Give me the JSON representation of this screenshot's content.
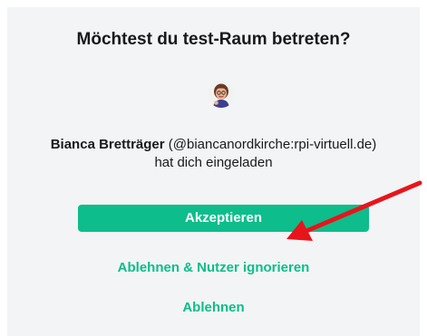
{
  "dialog": {
    "title": "Möchtest du test-Raum betreten?",
    "inviter_name": "Bianca Bretträger",
    "inviter_id": " (@biancanordkirche:rpi-virtuell.de)",
    "invite_suffix": "hat dich eingeladen",
    "accept_label": "Akzeptieren",
    "ignore_label": "Ablehnen & Nutzer ignorieren",
    "decline_label": "Ablehnen"
  },
  "colors": {
    "accent": "#0dbd8b",
    "annotation_arrow": "#e8141b",
    "panel_background": "#f2f4f5"
  },
  "icons": {
    "avatar": "memoji-avatar",
    "annotation": "red-arrow-annotation"
  }
}
